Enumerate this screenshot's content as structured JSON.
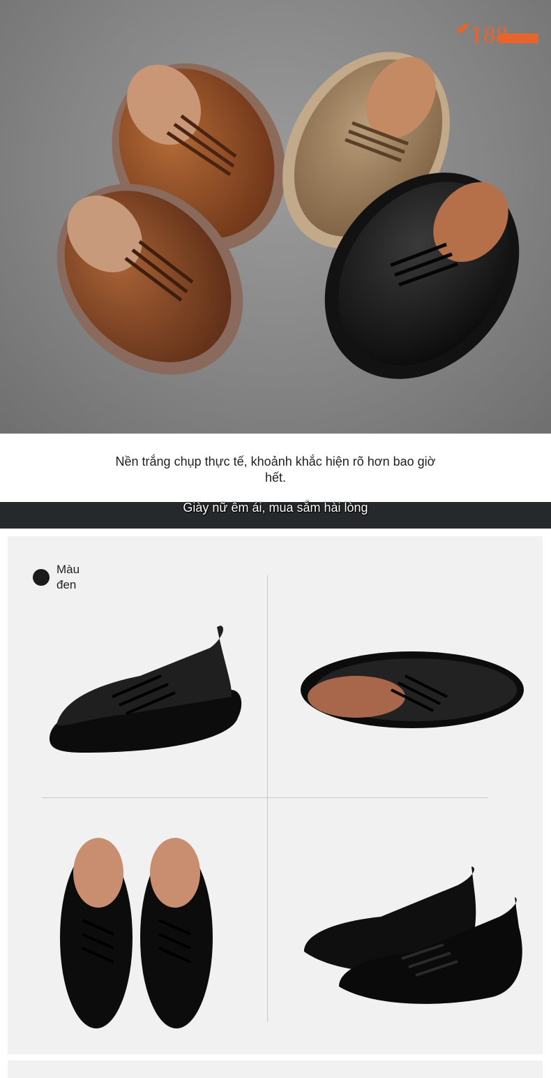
{
  "hero": {
    "image_description": "hero-shoes-photo",
    "logo_text": "188"
  },
  "caption": {
    "text": "Nền trắng chụp thực tế, khoảnh khắc hiện rõ hơn bao giờ hết."
  },
  "banner": {
    "text": "Giày nữ êm ái, mua sắm hài lòng",
    "color": "#26292c"
  },
  "gallery": {
    "color_label": "Màu đen",
    "swatch_color": "#1b1b1b"
  },
  "colors": {
    "accent": "#e8642c",
    "background": "#f1f1f1"
  }
}
